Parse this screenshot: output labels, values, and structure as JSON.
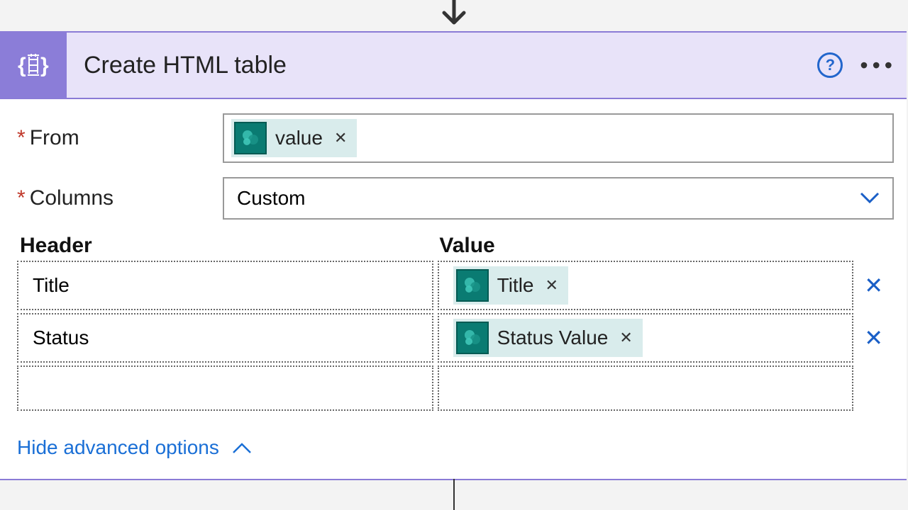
{
  "header": {
    "title": "Create HTML table"
  },
  "fields": {
    "from_label": "From",
    "from_token": "value",
    "columns_label": "Columns",
    "columns_value": "Custom"
  },
  "table": {
    "header_col": "Header",
    "value_col": "Value",
    "rows": [
      {
        "header": "Title",
        "token": "Title"
      },
      {
        "header": "Status",
        "token": "Status Value"
      }
    ]
  },
  "footer": {
    "hide_advanced": "Hide advanced options"
  }
}
